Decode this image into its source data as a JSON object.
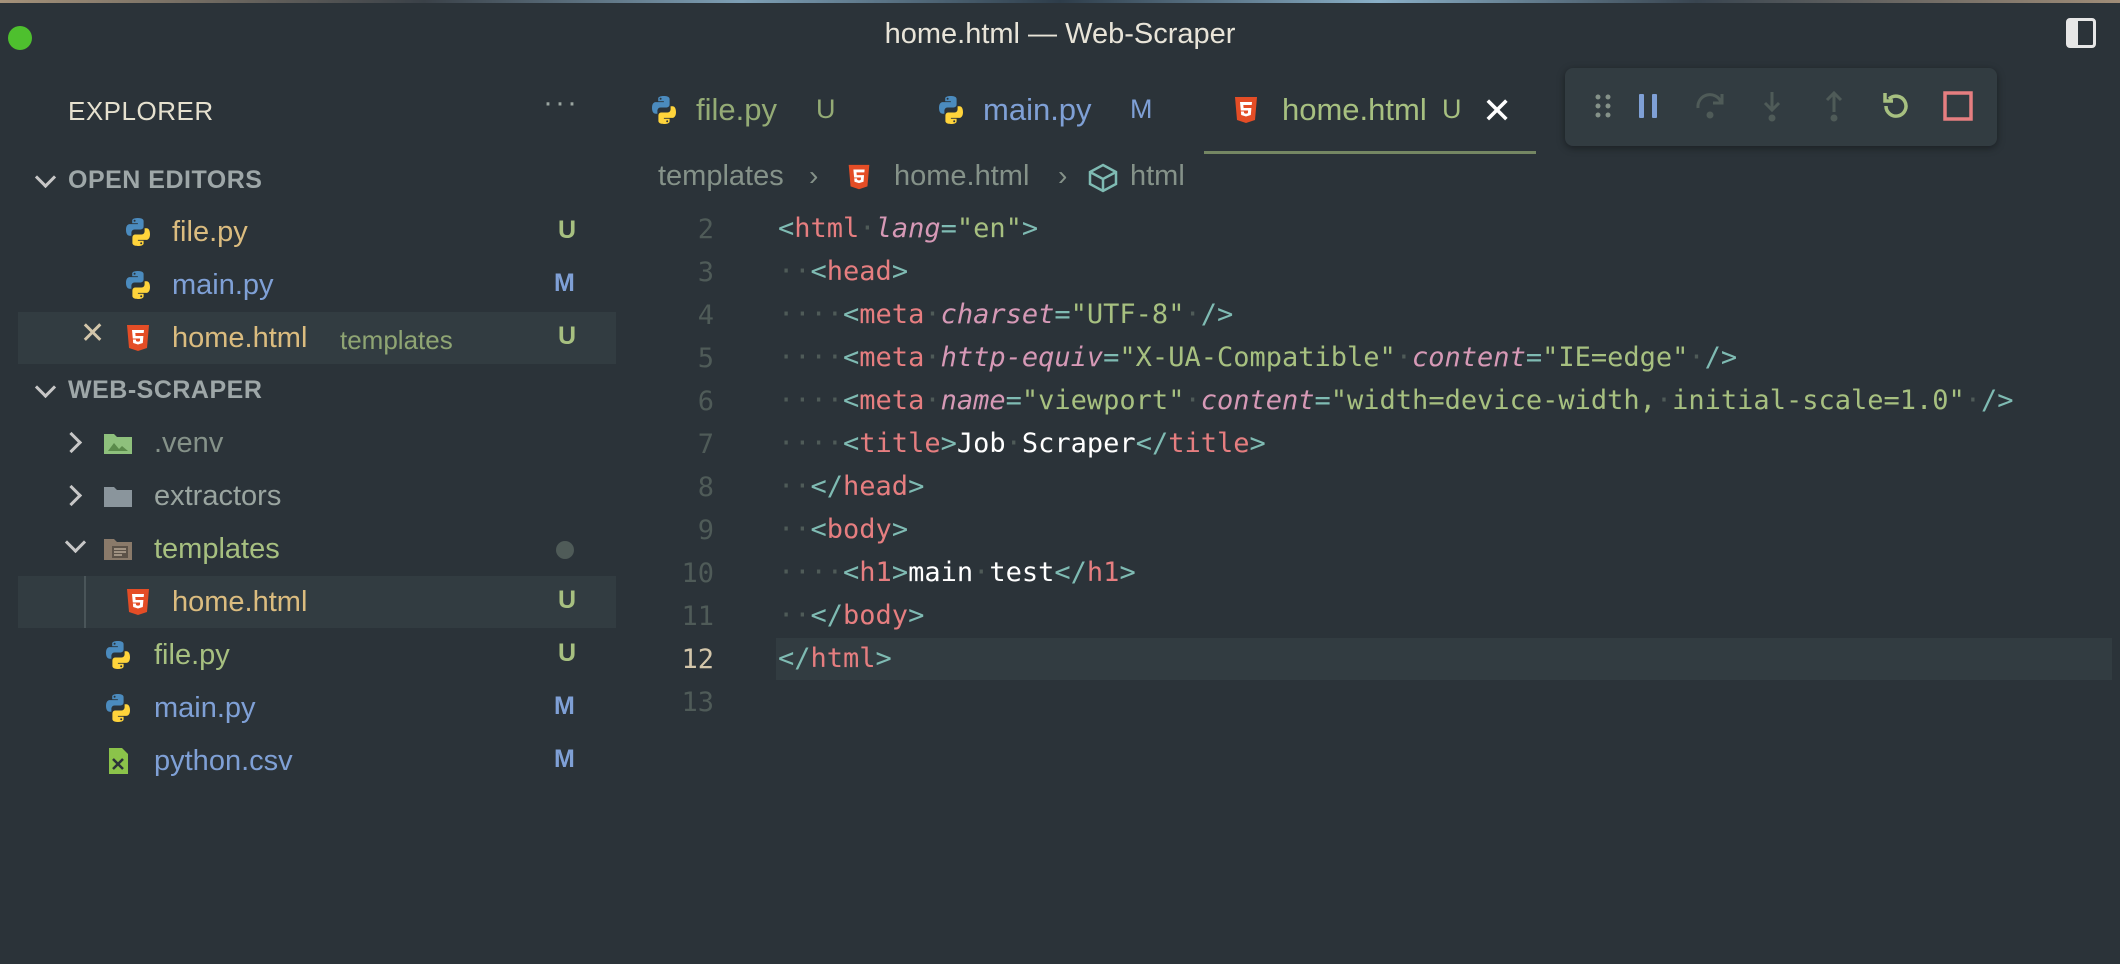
{
  "window": {
    "title": "home.html — Web-Scraper"
  },
  "explorer": {
    "header": "EXPLORER",
    "more": "···",
    "open_editors": {
      "title": "OPEN EDITORS",
      "items": [
        {
          "label": "file.py",
          "badge": "U",
          "icon": "python-icon"
        },
        {
          "label": "main.py",
          "badge": "M",
          "icon": "python-icon"
        },
        {
          "label": "home.html",
          "sub": "templates",
          "badge": "U",
          "icon": "html5-icon"
        }
      ]
    },
    "project": {
      "title": "WEB-SCRAPER",
      "items": [
        {
          "label": ".venv",
          "icon": "folder-env-icon"
        },
        {
          "label": "extractors",
          "icon": "folder-icon"
        },
        {
          "label": "templates",
          "icon": "folder-open-icon"
        },
        {
          "label": "home.html",
          "badge": "U",
          "icon": "html5-icon"
        },
        {
          "label": "file.py",
          "badge": "U",
          "icon": "python-icon"
        },
        {
          "label": "main.py",
          "badge": "M",
          "icon": "python-icon"
        },
        {
          "label": "python.csv",
          "badge": "M",
          "icon": "csv-icon"
        }
      ]
    }
  },
  "tabs": [
    {
      "label": "file.py",
      "badge": "U"
    },
    {
      "label": "main.py",
      "badge": "M"
    },
    {
      "label": "home.html",
      "badge": "U",
      "close": "✕"
    }
  ],
  "breadcrumb": {
    "folder": "templates",
    "file": "home.html",
    "symbol": "html"
  },
  "debug": {
    "icons": [
      "drag-handle-icon",
      "pause-icon",
      "step-over-icon",
      "step-into-icon",
      "step-out-icon",
      "restart-icon",
      "stop-icon"
    ]
  },
  "editor": {
    "line_numbers": [
      "2",
      "3",
      "4",
      "5",
      "6",
      "7",
      "8",
      "9",
      "10",
      "11",
      "12",
      "13"
    ],
    "current_line": "12",
    "code": {
      "l2_tag": "html",
      "l2_attr": "lang",
      "l2_val": "\"en\"",
      "l3_tag": "head",
      "l4_tag": "meta",
      "l4_attr": "charset",
      "l4_val": "\"UTF-8\"",
      "l5_tag": "meta",
      "l5_attr1": "http-equiv",
      "l5_val1": "\"X-UA-Compatible\"",
      "l5_attr2": "content",
      "l5_val2": "\"IE=edge\"",
      "l6_tag": "meta",
      "l6_attr1": "name",
      "l6_val1": "\"viewport\"",
      "l6_attr2": "content",
      "l6_val2": "\"width=device-width,",
      "l6_val2b": "initial-scale=1.0\"",
      "l7_tag": "title",
      "l7_text": "Job",
      "l7_text2": "Scraper",
      "l7_close": "title",
      "l8_close": "head",
      "l9_tag": "body",
      "l10_tag": "h1",
      "l10_text": "main",
      "l10_text2": "test",
      "l10_close": "h1",
      "l11_close": "body",
      "l12_close": "html"
    }
  }
}
